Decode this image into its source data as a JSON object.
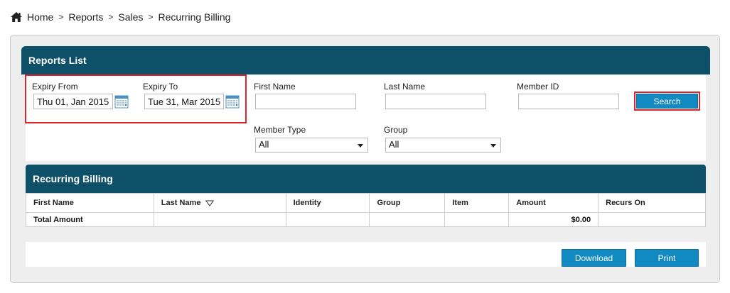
{
  "breadcrumb": {
    "items": [
      "Home",
      "Reports",
      "Sales",
      "Recurring Billing"
    ],
    "separator": ">"
  },
  "reports_list": {
    "title": "Reports List",
    "expiry_from": {
      "label": "Expiry From",
      "value": "Thu 01, Jan 2015"
    },
    "expiry_to": {
      "label": "Expiry To",
      "value": "Tue 31, Mar 2015"
    },
    "first_name": {
      "label": "First Name",
      "value": ""
    },
    "last_name": {
      "label": "Last Name",
      "value": ""
    },
    "member_id": {
      "label": "Member ID",
      "value": ""
    },
    "member_type": {
      "label": "Member Type",
      "value": "All"
    },
    "group": {
      "label": "Group",
      "value": "All"
    },
    "search_label": "Search"
  },
  "recurring_billing": {
    "title": "Recurring Billing",
    "columns": [
      "First Name",
      "Last Name",
      "Identity",
      "Group",
      "Item",
      "Amount",
      "Recurs On"
    ],
    "total_row": {
      "label": "Total Amount",
      "amount": "$0.00"
    }
  },
  "actions": {
    "download_label": "Download",
    "print_label": "Print"
  },
  "colors": {
    "header_bg": "#0e5068",
    "button_bg": "#1189c1",
    "highlight": "#e0242b",
    "panel_bg": "#eeeeee"
  }
}
